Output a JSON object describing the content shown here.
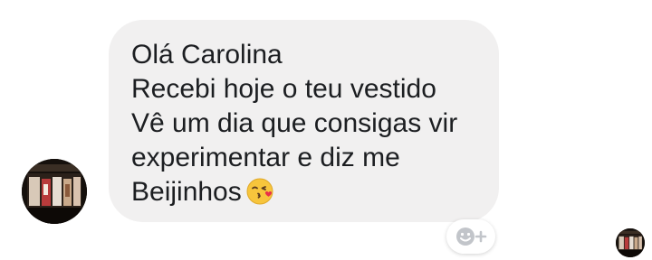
{
  "conversation": {
    "message": {
      "lines": [
        "Olá Carolina",
        "Recebi hoje o teu vestido",
        "Vê um dia que consigas vir",
        "experimentar e diz me",
        "Beijinhos"
      ],
      "emoji": "face-blowing-a-kiss"
    },
    "sender_avatar": "shop-storefront-photo",
    "reaction_button_icon": "smiley-plus-icon",
    "read_receipt_avatar": "shop-storefront-photo"
  }
}
